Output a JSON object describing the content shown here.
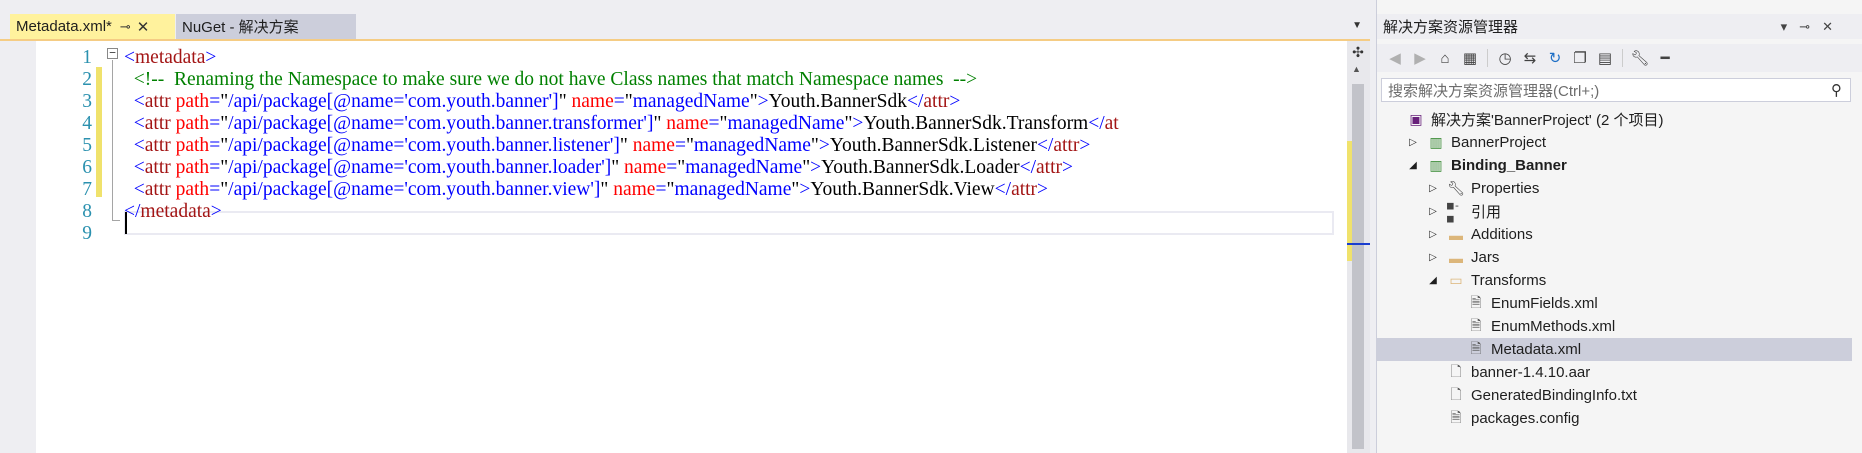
{
  "editor": {
    "tabs": [
      {
        "label": "Metadata.xml*",
        "pin": "⊸",
        "close": "✕"
      },
      {
        "label": "NuGet - 解决方案"
      }
    ],
    "tab_dropdown": "▼",
    "lines": [
      {
        "num": "1",
        "parts": [
          {
            "t": "<",
            "c": "br"
          },
          {
            "t": "metadata",
            "c": "tag"
          },
          {
            "t": ">",
            "c": "br"
          }
        ]
      },
      {
        "num": "2",
        "parts": [
          {
            "t": "  <!--  Renaming the Namespace to make sure we do not have Class names that match Namespace names  -->",
            "c": "comment"
          }
        ]
      },
      {
        "num": "3",
        "parts": [
          {
            "t": "  <",
            "c": "br"
          },
          {
            "t": "attr",
            "c": "tag"
          },
          {
            "t": " path",
            "c": "attr"
          },
          {
            "t": "=",
            "c": "br"
          },
          {
            "t": "\"",
            "c": "plain"
          },
          {
            "t": "/api/package[@name='com.youth.banner']",
            "c": "val"
          },
          {
            "t": "\"",
            "c": "plain"
          },
          {
            "t": " name",
            "c": "attr"
          },
          {
            "t": "=",
            "c": "br"
          },
          {
            "t": "\"",
            "c": "plain"
          },
          {
            "t": "managedName",
            "c": "val"
          },
          {
            "t": "\"",
            "c": "plain"
          },
          {
            "t": ">",
            "c": "br"
          },
          {
            "t": "Youth.BannerSdk",
            "c": "plain"
          },
          {
            "t": "</",
            "c": "br"
          },
          {
            "t": "attr",
            "c": "tag"
          },
          {
            "t": ">",
            "c": "br"
          }
        ]
      },
      {
        "num": "4",
        "parts": [
          {
            "t": "  <",
            "c": "br"
          },
          {
            "t": "attr",
            "c": "tag"
          },
          {
            "t": " path",
            "c": "attr"
          },
          {
            "t": "=",
            "c": "br"
          },
          {
            "t": "\"",
            "c": "plain"
          },
          {
            "t": "/api/package[@name='com.youth.banner.transformer']",
            "c": "val"
          },
          {
            "t": "\"",
            "c": "plain"
          },
          {
            "t": " name",
            "c": "attr"
          },
          {
            "t": "=",
            "c": "br"
          },
          {
            "t": "\"",
            "c": "plain"
          },
          {
            "t": "managedName",
            "c": "val"
          },
          {
            "t": "\"",
            "c": "plain"
          },
          {
            "t": ">",
            "c": "br"
          },
          {
            "t": "Youth.BannerSdk.Transform",
            "c": "plain"
          },
          {
            "t": "</",
            "c": "br"
          },
          {
            "t": "at",
            "c": "tag"
          }
        ]
      },
      {
        "num": "5",
        "parts": [
          {
            "t": "  <",
            "c": "br"
          },
          {
            "t": "attr",
            "c": "tag"
          },
          {
            "t": " path",
            "c": "attr"
          },
          {
            "t": "=",
            "c": "br"
          },
          {
            "t": "\"",
            "c": "plain"
          },
          {
            "t": "/api/package[@name='com.youth.banner.listener']",
            "c": "val"
          },
          {
            "t": "\"",
            "c": "plain"
          },
          {
            "t": " name",
            "c": "attr"
          },
          {
            "t": "=",
            "c": "br"
          },
          {
            "t": "\"",
            "c": "plain"
          },
          {
            "t": "managedName",
            "c": "val"
          },
          {
            "t": "\"",
            "c": "plain"
          },
          {
            "t": ">",
            "c": "br"
          },
          {
            "t": "Youth.BannerSdk.Listener",
            "c": "plain"
          },
          {
            "t": "</",
            "c": "br"
          },
          {
            "t": "attr",
            "c": "tag"
          },
          {
            "t": ">",
            "c": "br"
          }
        ]
      },
      {
        "num": "6",
        "parts": [
          {
            "t": "  <",
            "c": "br"
          },
          {
            "t": "attr",
            "c": "tag"
          },
          {
            "t": " path",
            "c": "attr"
          },
          {
            "t": "=",
            "c": "br"
          },
          {
            "t": "\"",
            "c": "plain"
          },
          {
            "t": "/api/package[@name='com.youth.banner.loader']",
            "c": "val"
          },
          {
            "t": "\"",
            "c": "plain"
          },
          {
            "t": " name",
            "c": "attr"
          },
          {
            "t": "=",
            "c": "br"
          },
          {
            "t": "\"",
            "c": "plain"
          },
          {
            "t": "managedName",
            "c": "val"
          },
          {
            "t": "\"",
            "c": "plain"
          },
          {
            "t": ">",
            "c": "br"
          },
          {
            "t": "Youth.BannerSdk.Loader",
            "c": "plain"
          },
          {
            "t": "</",
            "c": "br"
          },
          {
            "t": "attr",
            "c": "tag"
          },
          {
            "t": ">",
            "c": "br"
          }
        ]
      },
      {
        "num": "7",
        "parts": [
          {
            "t": "  <",
            "c": "br"
          },
          {
            "t": "attr",
            "c": "tag"
          },
          {
            "t": " path",
            "c": "attr"
          },
          {
            "t": "=",
            "c": "br"
          },
          {
            "t": "\"",
            "c": "plain"
          },
          {
            "t": "/api/package[@name='com.youth.banner.view']",
            "c": "val"
          },
          {
            "t": "\"",
            "c": "plain"
          },
          {
            "t": " name",
            "c": "attr"
          },
          {
            "t": "=",
            "c": "br"
          },
          {
            "t": "\"",
            "c": "plain"
          },
          {
            "t": "managedName",
            "c": "val"
          },
          {
            "t": "\"",
            "c": "plain"
          },
          {
            "t": ">",
            "c": "br"
          },
          {
            "t": "Youth.BannerSdk.View",
            "c": "plain"
          },
          {
            "t": "</",
            "c": "br"
          },
          {
            "t": "attr",
            "c": "tag"
          },
          {
            "t": ">",
            "c": "br"
          }
        ]
      },
      {
        "num": "8",
        "parts": [
          {
            "t": "</",
            "c": "br"
          },
          {
            "t": "metadata",
            "c": "tag"
          },
          {
            "t": ">",
            "c": "br"
          }
        ]
      },
      {
        "num": "9",
        "parts": []
      }
    ]
  },
  "solution_explorer": {
    "title": "解决方案资源管理器",
    "title_icons": [
      "▾",
      "⊸",
      "✕"
    ],
    "search_placeholder": "搜索解决方案资源管理器(Ctrl+;)",
    "search_icon": "⚲",
    "toolbar_icons": [
      "back-icon",
      "forward-icon",
      "home-icon",
      "switch-views-icon",
      "history-icon",
      "sync-icon",
      "refresh-icon",
      "collapse-all-icon",
      "show-all-files-icon",
      "properties-icon",
      "preview-icon"
    ],
    "tree": [
      {
        "label": "解决方案'BannerProject' (2 个项目)",
        "icon": "solution-icon",
        "arrow": "",
        "bold": false,
        "indent": 0,
        "selected": false
      },
      {
        "label": "BannerProject",
        "icon": "project-icon",
        "arrow": "▷",
        "bold": false,
        "indent": 1,
        "selected": false
      },
      {
        "label": "Binding_Banner",
        "icon": "project-icon",
        "arrow": "◢",
        "bold": true,
        "indent": 1,
        "selected": false
      },
      {
        "label": "Properties",
        "icon": "wrench-icon",
        "arrow": "▷",
        "bold": false,
        "indent": 2,
        "selected": false
      },
      {
        "label": "引用",
        "icon": "references-icon",
        "arrow": "▷",
        "bold": false,
        "indent": 2,
        "selected": false
      },
      {
        "label": "Additions",
        "icon": "folder-icon",
        "arrow": "▷",
        "bold": false,
        "indent": 2,
        "selected": false
      },
      {
        "label": "Jars",
        "icon": "folder-icon",
        "arrow": "▷",
        "bold": false,
        "indent": 2,
        "selected": false
      },
      {
        "label": "Transforms",
        "icon": "folder-open-icon",
        "arrow": "◢",
        "bold": false,
        "indent": 2,
        "selected": false
      },
      {
        "label": "EnumFields.xml",
        "icon": "xml-file-icon",
        "arrow": "",
        "bold": false,
        "indent": 3,
        "selected": false
      },
      {
        "label": "EnumMethods.xml",
        "icon": "xml-file-icon",
        "arrow": "",
        "bold": false,
        "indent": 3,
        "selected": false
      },
      {
        "label": "Metadata.xml",
        "icon": "xml-file-icon",
        "arrow": "",
        "bold": false,
        "indent": 3,
        "selected": true
      },
      {
        "label": "banner-1.4.10.aar",
        "icon": "file-icon",
        "arrow": "",
        "bold": false,
        "indent": 2,
        "selected": false
      },
      {
        "label": "GeneratedBindingInfo.txt",
        "icon": "file-icon",
        "arrow": "",
        "bold": false,
        "indent": 2,
        "selected": false
      },
      {
        "label": "packages.config",
        "icon": "config-file-icon",
        "arrow": "",
        "bold": false,
        "indent": 2,
        "selected": false
      }
    ]
  },
  "colors": {
    "active_tab": "#fff29d",
    "tag": "#a31515",
    "attribute": "#ff0000",
    "value": "#0000ff",
    "comment": "#008000",
    "line_number": "#2b91af",
    "selection": "#cccedb"
  }
}
